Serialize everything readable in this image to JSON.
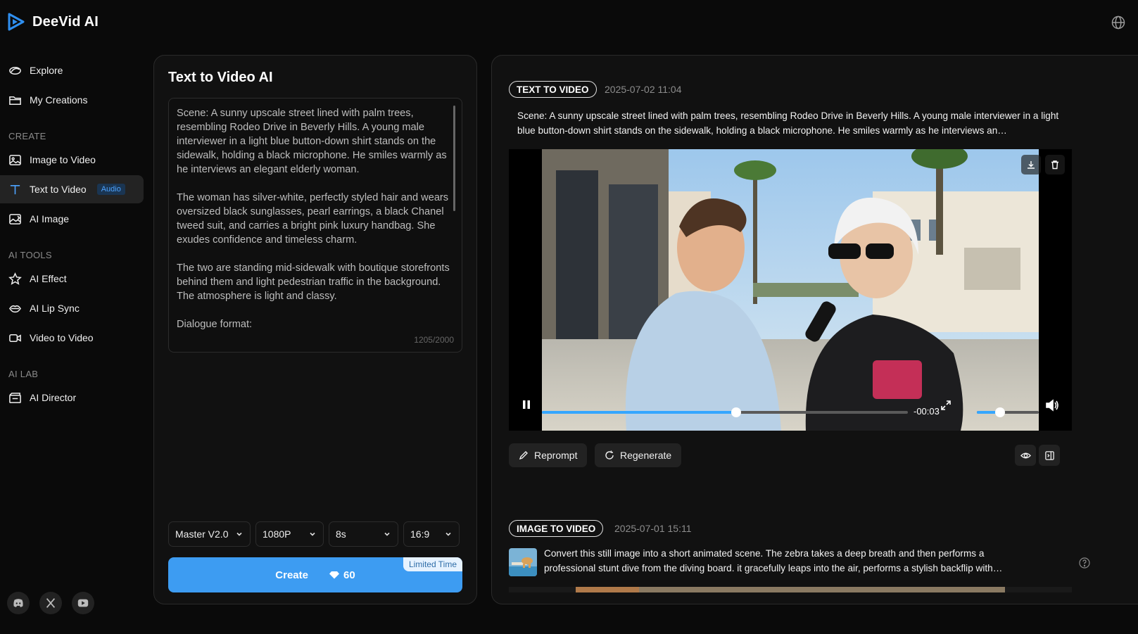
{
  "app": {
    "name": "DeeVid AI"
  },
  "sidebar": {
    "top_items": [
      {
        "label": "Explore",
        "icon": "explore-icon"
      },
      {
        "label": "My Creations",
        "icon": "folder-icon"
      }
    ],
    "sections": [
      {
        "title": "CREATE",
        "items": [
          {
            "label": "Image to Video",
            "icon": "image-icon"
          },
          {
            "label": "Text to Video",
            "icon": "text-icon",
            "badge": "Audio",
            "active": true
          },
          {
            "label": "AI Image",
            "icon": "ai-image-icon"
          }
        ]
      },
      {
        "title": "AI TOOLS",
        "items": [
          {
            "label": "AI Effect",
            "icon": "sparkle-icon"
          },
          {
            "label": "AI Lip Sync",
            "icon": "lips-icon"
          },
          {
            "label": "Video to Video",
            "icon": "video-camera-icon"
          }
        ]
      },
      {
        "title": "AI LAB",
        "items": [
          {
            "label": "AI Director",
            "icon": "director-icon"
          }
        ]
      }
    ],
    "socials": [
      "discord-icon",
      "x-icon",
      "youtube-icon"
    ]
  },
  "editor": {
    "title": "Text to Video AI",
    "prompt": "Scene: A sunny upscale street lined with palm trees, resembling Rodeo Drive in Beverly Hills. A young male interviewer in a light blue button-down shirt stands on the sidewalk, holding a black microphone. He smiles warmly as he interviews an elegant elderly woman.\n\nThe woman has silver-white, perfectly styled hair and wears oversized black sunglasses, pearl earrings, a black Chanel tweed suit, and carries a bright pink luxury handbag. She exudes confidence and timeless charm.\n\nThe two are standing mid-sidewalk with boutique storefronts behind them and light pedestrian traffic in the background. The atmosphere is light and classy.\n\nDialogue format:",
    "char_count": "1205/2000",
    "options": {
      "model": "Master V2.0",
      "resolution": "1080P",
      "duration": "8s",
      "aspect": "16:9"
    },
    "create": {
      "label": "Create",
      "cost": "60",
      "limited": "Limited Time"
    }
  },
  "history": {
    "first": {
      "tag": "TEXT TO VIDEO",
      "date": "2025-07-02 11:04",
      "description": "Scene: A sunny upscale street lined with palm trees, resembling Rodeo Drive in Beverly Hills. A young male interviewer in a light blue button-down shirt stands on the sidewalk, holding a black microphone. He smiles warmly as he interviews an…",
      "player": {
        "time": "-00:03",
        "progress": 0.53,
        "volume": 0.38
      },
      "actions": {
        "reprompt": "Reprompt",
        "regenerate": "Regenerate"
      }
    },
    "second": {
      "tag": "IMAGE TO VIDEO",
      "date": "2025-07-01 15:11",
      "description": "Convert this still image into a short animated scene. The zebra takes a deep breath and then performs a professional stunt dive from the diving board. it gracefully leaps into the air, performs a stylish backflip with…"
    }
  },
  "colors": {
    "accent": "#3d9cf2",
    "progress": "#35a6ff",
    "badge": "#4da3ff"
  }
}
